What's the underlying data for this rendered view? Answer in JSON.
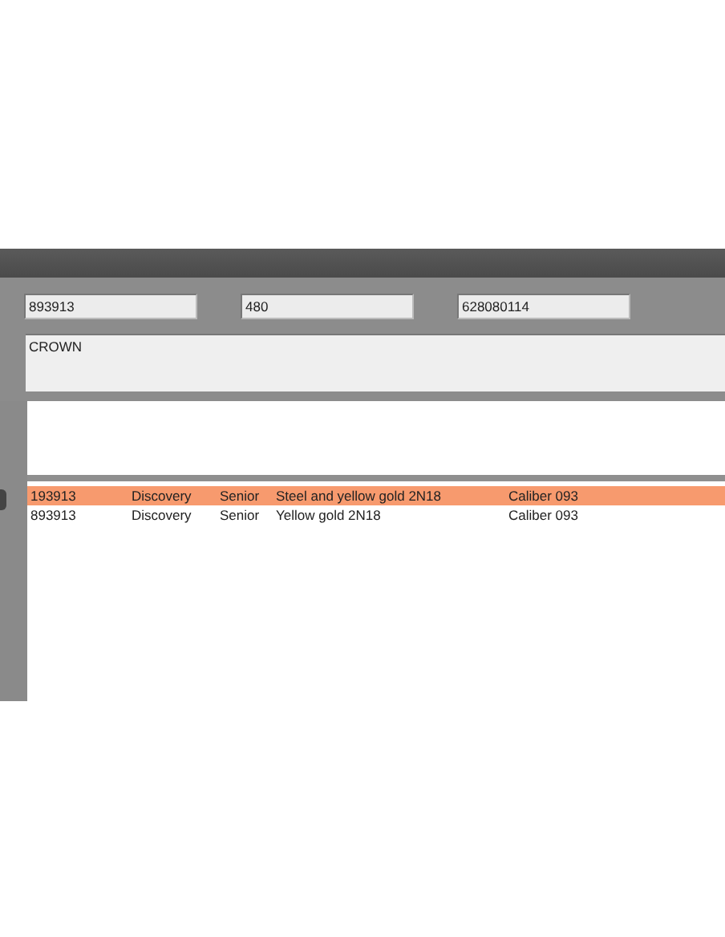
{
  "fields": [
    "893913",
    "480",
    "628080114"
  ],
  "description": "CROWN",
  "rows": [
    {
      "cells": [
        "193913",
        "Discovery",
        "Senior",
        "Steel and yellow gold 2N18",
        "Caliber 093"
      ],
      "selected": true
    },
    {
      "cells": [
        "893913",
        "Discovery",
        "Senior",
        "Yellow gold 2N18",
        "Caliber 093"
      ],
      "selected": false
    }
  ]
}
